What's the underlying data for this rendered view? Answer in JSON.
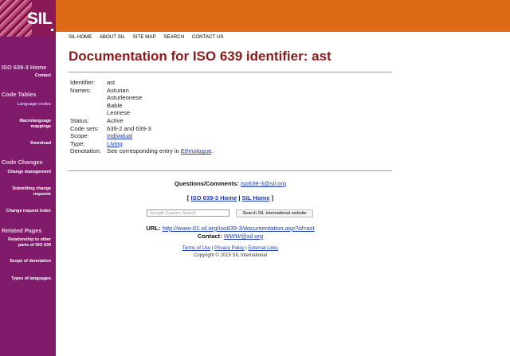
{
  "header": {
    "logo_text": "SIL",
    "nav": [
      "SIL HOME",
      "ABOUT SIL",
      "SITE MAP",
      "SEARCH",
      "CONTACT US"
    ]
  },
  "sidebar": {
    "home": "ISO 639-3 Home",
    "contact": "Contact",
    "code_tables": "Code Tables",
    "language_codes": "Language codes",
    "macrolanguage_mappings": "Macrolanguage mappings",
    "download": "Download",
    "code_changes": "Code Changes",
    "change_management": "Change management",
    "submitting_change_requests": "Submitting change requests",
    "change_request_index": "Change request index",
    "related_pages": "Related Pages",
    "relationship": "Relationship to other parts of ISO 639",
    "scope_of_denotation": "Scope of denotation",
    "types_of_languages": "Types of languages"
  },
  "page": {
    "title": "Documentation for ISO 639 identifier: ast",
    "identifier_label": "Identifier:",
    "identifier_value": "ast",
    "names_label": "Names:",
    "names": [
      "Asturian",
      "Asturleonese",
      "Bable",
      "Leonese"
    ],
    "status_label": "Status:",
    "status_value": "Active",
    "code_sets_label": "Code sets:",
    "code_sets_value": "639-2 and 639-3",
    "scope_label": "Scope:",
    "scope_value": "Individual",
    "type_label": "Type:",
    "type_value": "Living",
    "denotation_label": "Denotation:",
    "denotation_prefix": "See corresponding entry in",
    "denotation_link": "Ethnologue",
    "denotation_suffix": "."
  },
  "contact_block": {
    "questions_label": "Questions/Comments:",
    "questions_email": "iso639-3@sil.org",
    "bracket_open": "[",
    "iso_home_link": "ISO 639-3 Home",
    "separator": "|",
    "sil_home_link": "SIL Home",
    "bracket_close": "]",
    "search_placeholder": "Google  Custom Search",
    "search_button": "Search SIL International website",
    "url_label": "URL:",
    "url_value": "http://www-01.sil.org/iso639-3/documentation.asp?id=ast",
    "contact_label": "Contact:",
    "contact_value": "WWW@sil.org"
  },
  "footer": {
    "terms": "Terms of Use",
    "sep1": "|",
    "privacy": "Privacy Policy",
    "sep2": "|",
    "external": "External Links",
    "copyright": "Copyright © 2015 SIL International"
  },
  "colors": {
    "header_orange": "#de6a16",
    "sidebar_purple": "#801b6b",
    "title_red": "#8b1a1a",
    "link_blue": "#1a3ab0"
  }
}
